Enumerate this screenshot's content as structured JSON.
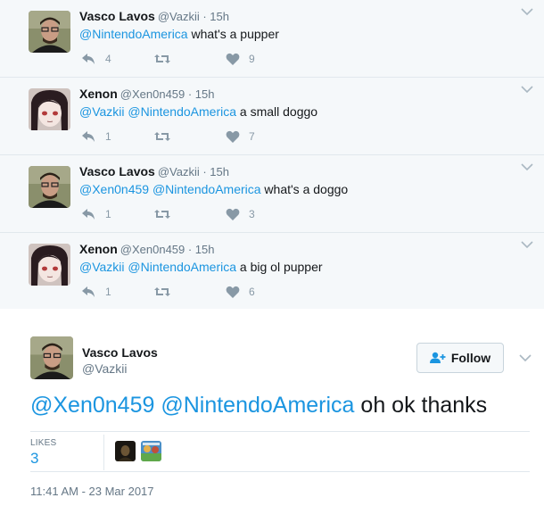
{
  "replies": [
    {
      "name": "Vasco Lavos",
      "meta": "@Vazkii · 15h",
      "avatar_icon": "vasco-avatar",
      "mentions": "@NintendoAmerica",
      "text": " what's a pupper",
      "reply_count": "4",
      "like_count": "9"
    },
    {
      "name": "Xenon",
      "meta": "@Xen0n459 · 15h",
      "avatar_icon": "xenon-avatar",
      "mentions": "@Vazkii @NintendoAmerica",
      "text": " a small doggo",
      "reply_count": "1",
      "like_count": "7"
    },
    {
      "name": "Vasco Lavos",
      "meta": "@Vazkii · 15h",
      "avatar_icon": "vasco-avatar",
      "mentions": "@Xen0n459 @NintendoAmerica",
      "text": " what's a doggo",
      "reply_count": "1",
      "like_count": "3"
    },
    {
      "name": "Xenon",
      "meta": "@Xen0n459 · 15h",
      "avatar_icon": "xenon-avatar",
      "mentions": "@Vazkii @NintendoAmerica",
      "text": " a big ol pupper",
      "reply_count": "1",
      "like_count": "6"
    }
  ],
  "main": {
    "name": "Vasco Lavos",
    "handle": "@Vazkii",
    "follow_label": "Follow",
    "mentions": "@Xen0n459 @NintendoAmerica",
    "text": " oh ok thanks",
    "likes_label": "LIKES",
    "likes_count": "3",
    "timestamp": "11:41 AM - 23 Mar 2017"
  },
  "colors": {
    "link": "#1b95e0",
    "icon_gray": "#8899a6",
    "reply_bg": "#f5f8fa"
  }
}
